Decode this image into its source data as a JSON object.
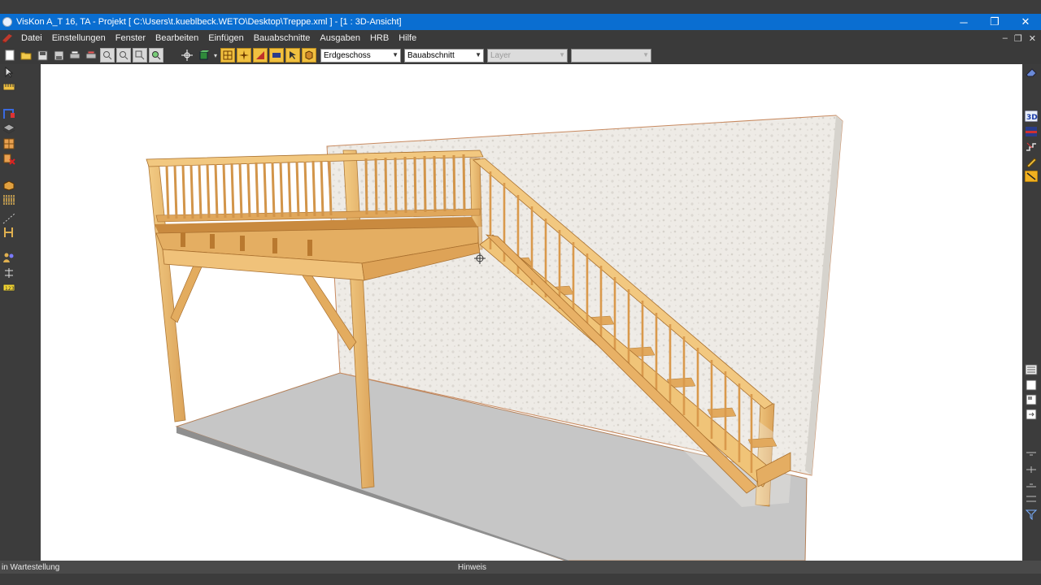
{
  "window": {
    "title": "VisKon A_T 16, TA - Projekt [ C:\\Users\\t.kueblbeck.WETO\\Desktop\\Treppe.xml ]  - [1 : 3D-Ansicht]",
    "controls": {
      "minimize": "─",
      "restore": "❐",
      "close": "✕"
    }
  },
  "menu": {
    "items": [
      "Datei",
      "Einstellungen",
      "Fenster",
      "Bearbeiten",
      "Einfügen",
      "Bauabschnitte",
      "Ausgaben",
      "HRB",
      "Hilfe"
    ],
    "mdi_controls": {
      "minimize": "–",
      "restore": "❐",
      "close": "✕"
    }
  },
  "toolbar": {
    "floor_select": "Erdgeschoss",
    "section_select": "Bauabschnitt",
    "layer_select_placeholder": "Layer",
    "extra_select": ""
  },
  "status": {
    "left": "in Wartestellung",
    "hint": "Hinweis"
  },
  "colors": {
    "titlebar": "#0a6ed1",
    "chrome": "#3c3c3c",
    "wood": "#e9b66a",
    "wood_dark": "#c98a3f",
    "floor": "#c4c4c4",
    "wall": "#ece9e4"
  }
}
